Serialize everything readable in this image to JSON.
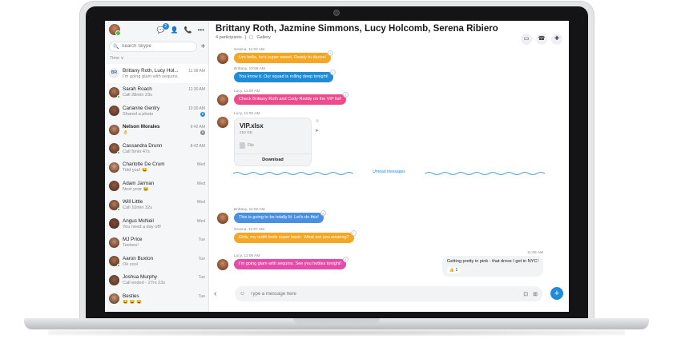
{
  "sidebar": {
    "search_placeholder": "Search Skype",
    "time_filter": "Time ∨",
    "notif_count": "2",
    "conversations": [
      {
        "name": "Brittany Roth, Lucy Hol...",
        "time": "11:08 AM",
        "preview": "I'm going glam with sequins.",
        "initials": "BR",
        "bold": false,
        "active": true
      },
      {
        "name": "Sarah Roach",
        "time": "11:30 AM",
        "preview": "Call 28min 23s",
        "bold": false
      },
      {
        "name": "Carianne Gentry",
        "time": "10:30 AM",
        "preview": "Shared a photo",
        "count": "5",
        "bold": false
      },
      {
        "name": "Nelson Morales",
        "time": "9:42 AM",
        "preview": "👌",
        "bold": true,
        "muted": true
      },
      {
        "name": "Cassandra Drunn",
        "time": "8:42 AM",
        "preview": "Call 5min 47s",
        "bold": false
      },
      {
        "name": "Charlotte De Crum",
        "time": "Wed",
        "preview": "Told you! 😀",
        "bold": false
      },
      {
        "name": "Adam Jarman",
        "time": "Wed",
        "preview": "Next year 😄",
        "bold": false
      },
      {
        "name": "Will Little",
        "time": "Wed",
        "preview": "Call 10min 32s",
        "bold": false
      },
      {
        "name": "Angus McNeil",
        "time": "Wed",
        "preview": "You need a day off!",
        "bold": false
      },
      {
        "name": "MJ Price",
        "time": "Tue",
        "preview": "Teehee!",
        "bold": false
      },
      {
        "name": "Aaron Buxton",
        "time": "Tue",
        "preview": "Ok cool",
        "bold": false
      },
      {
        "name": "Joshua Murphy",
        "time": "Tue",
        "preview": "Call ended - 27m 23s",
        "bold": false
      },
      {
        "name": "Besties",
        "time": "Tue",
        "preview": "😀 😀 😀",
        "bold": false
      }
    ]
  },
  "chat": {
    "title": "Brittany Roth, Jazmine Simmons, Lucy Holcomb, Serena Ribiero",
    "participants": "4 participants",
    "gallery": "Gallery",
    "messages": [
      {
        "meta": "Serena, 11:02 AM",
        "text": "Um hello, he's super sweet. Ready to dance!",
        "color": "#f5a623"
      },
      {
        "meta": "Brittany, 10:58 AM",
        "text": "You know it. Our squad is rolling deep tonight!",
        "color": "#1e8cd9"
      },
      {
        "meta": "Lucy, 11:00 AM",
        "text": "Check Brittany Roth and Cody Roddy on the VIP list!",
        "color": "#ee4b8f"
      },
      {
        "meta": "Lucy, 11:00 AM"
      },
      {
        "meta": "Brittany, 11:02 AM",
        "text": "This is going to be totally lit. Let's do this!",
        "color": "#4a90e2"
      },
      {
        "meta": "Serena, 11:07 AM",
        "text": "Girls, my outfit feels super basic. What are you wearing?",
        "color": "#f5a623"
      },
      {
        "meta": "Lucy, 11:08 AM",
        "text": "I'm going glam with sequins. See you hotties tonight!",
        "color": "#e64ba9"
      }
    ],
    "file": {
      "name": "VIP.xlsx",
      "size": "252 KB",
      "type": "File",
      "download": "Download"
    },
    "unread_label": "Unread messages",
    "outgoing": {
      "time": "11:08 AM",
      "text": "Getting pretty in pink - that dress I got in NYC!",
      "reaction": "👍 1"
    },
    "composer_placeholder": "Type a message here"
  }
}
